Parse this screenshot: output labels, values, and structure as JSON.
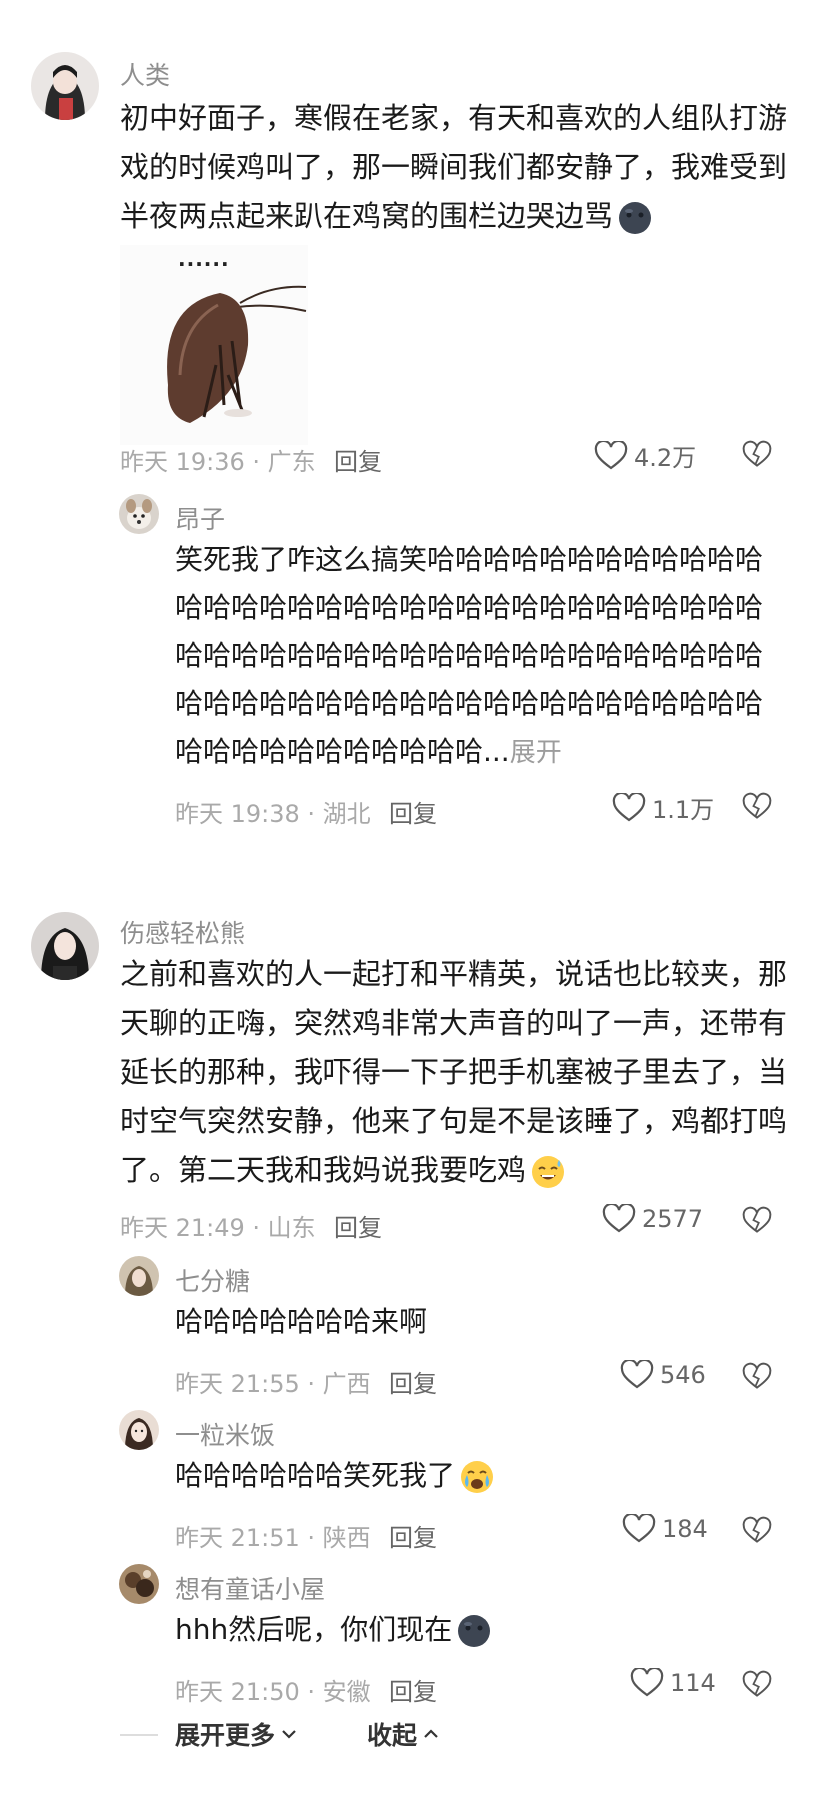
{
  "comments": [
    {
      "username": "人类",
      "lines": [
        "初中好面子，寒假在老家，有天和喜欢的人组队打游",
        "戏的时候鸡叫了，那一瞬间我们都安静了，我难受到",
        "半夜两点起来趴在鸡窝的围栏边哭边骂"
      ],
      "emoji": "dark-face-emoji",
      "sticker": {
        "caption": "......",
        "icon": "sad-cockroach-sticker"
      },
      "meta": "昨天 19:36 · 广东",
      "reply_label": "回复",
      "likes": "4.2万",
      "replies": [
        {
          "username": "昂子",
          "lines": [
            "笑死我了咋这么搞笑哈哈哈哈哈哈哈哈哈哈哈哈",
            "哈哈哈哈哈哈哈哈哈哈哈哈哈哈哈哈哈哈哈哈哈",
            "哈哈哈哈哈哈哈哈哈哈哈哈哈哈哈哈哈哈哈哈哈",
            "哈哈哈哈哈哈哈哈哈哈哈哈哈哈哈哈哈哈哈哈哈",
            "哈哈哈哈哈哈哈哈哈哈哈..."
          ],
          "expand_label": "展开",
          "meta": "昨天 19:38 · 湖北",
          "reply_label": "回复",
          "likes": "1.1万"
        }
      ]
    },
    {
      "username": "伤感轻松熊",
      "lines": [
        "之前和喜欢的人一起打和平精英，说话也比较夹，那",
        "天聊的正嗨，突然鸡非常大声音的叫了一声，还带有",
        "延长的那种，我吓得一下子把手机塞被子里去了，当",
        "时空气突然安静，他来了句是不是该睡了，鸡都打鸣",
        "了。第二天我和我妈说我要吃鸡"
      ],
      "emoji": "sweat-smile-emoji",
      "meta": "昨天 21:49 · 山东",
      "reply_label": "回复",
      "likes": "2577",
      "replies": [
        {
          "username": "七分糖",
          "text": "哈哈哈哈哈哈哈来啊",
          "meta": "昨天 21:55 · 广西",
          "reply_label": "回复",
          "likes": "546"
        },
        {
          "username": "一粒米饭",
          "text": "哈哈哈哈哈哈笑死我了",
          "emoji": "crying-laughing-emoji",
          "meta": "昨天 21:51 · 陕西",
          "reply_label": "回复",
          "likes": "184"
        },
        {
          "username": "想有童话小屋",
          "text": "hhh然后呢，你们现在",
          "emoji": "dark-face-emoji",
          "meta": "昨天 21:50 · 安徽",
          "reply_label": "回复",
          "likes": "114"
        }
      ]
    }
  ],
  "footer": {
    "expand_more": "展开更多",
    "collapse": "收起"
  },
  "colors": {
    "text": "#1a1a1a",
    "muted": "#a9a9a9",
    "username": "#8e8e8e"
  }
}
